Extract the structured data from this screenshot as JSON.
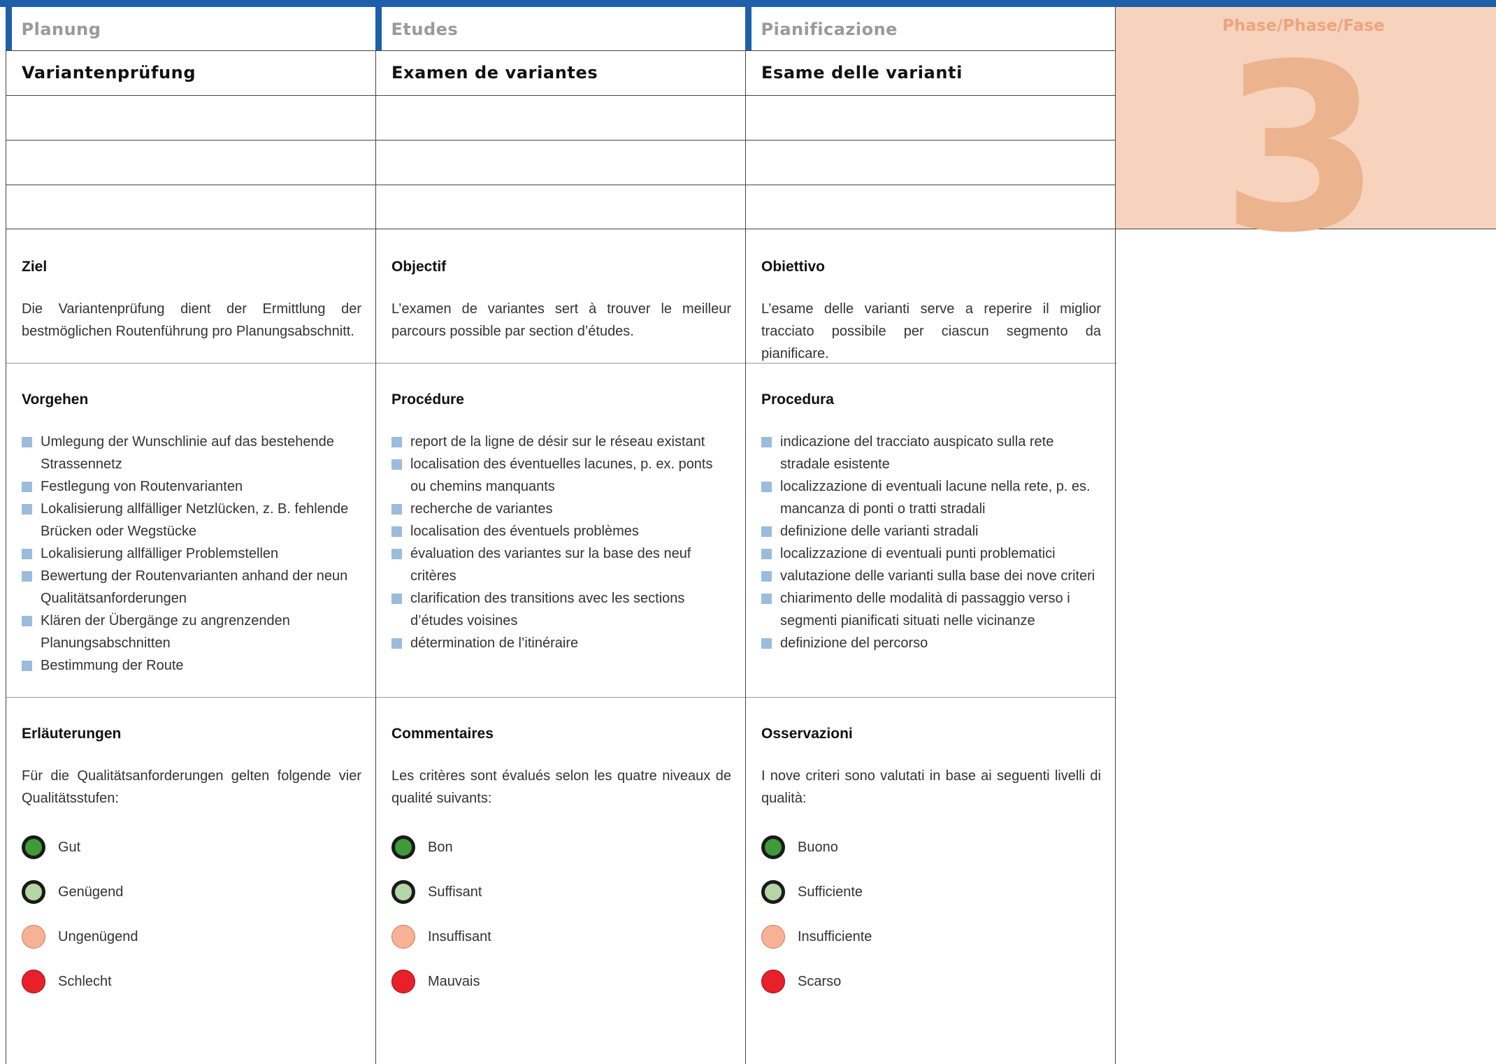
{
  "colors": {
    "accent": "#1d5fa8",
    "bullet": "#9bbcdc",
    "phase_bg": "#f7d2bd",
    "phase_text": "#ecb38f"
  },
  "columns": [
    {
      "header": "Planung",
      "title": "Variantenprüfung",
      "goal_heading": "Ziel",
      "goal_text": "Die Variantenprüfung dient der Ermittlung der bestmöglichen Routenführung pro Planungsabschnitt.",
      "proc_heading": "Vorgehen",
      "proc_items": [
        "Umlegung der Wunschlinie auf das bestehende Strassennetz",
        "Festlegung von Routenvarianten",
        "Lokalisierung allfälliger Netzlücken, z. B. fehlende Brücken oder Wegstücke",
        "Lokalisierung allfälliger Problemstellen",
        "Bewertung der Routenvarianten anhand der neun Qualitätsanforderungen",
        "Klären der Übergänge zu angrenzenden Planungsabschnitten",
        "Bestimmung der Route"
      ],
      "expl_heading": "Erläuterungen",
      "expl_text": "Für die Qualitätsanforderungen gelten folgende vier Qualitätsstufen:",
      "levels": [
        "Gut",
        "Genügend",
        "Ungenügend",
        "Schlecht"
      ]
    },
    {
      "header": "Etudes",
      "title": "Examen de variantes",
      "goal_heading": "Objectif",
      "goal_text": "L’examen de variantes sert à trouver le meilleur parcours possible par section d’études.",
      "proc_heading": "Procédure",
      "proc_items": [
        "report de la ligne de désir sur le réseau existant",
        "localisation des éventuelles lacunes, p. ex. ponts ou chemins manquants",
        "recherche de variantes",
        "localisation des éventuels problèmes",
        "évaluation des variantes sur la base des neuf critères",
        "clarification des transitions avec les sections d’études voisines",
        "détermination de l’itinéraire"
      ],
      "expl_heading": "Commentaires",
      "expl_text": "Les critères sont évalués selon les quatre niveaux de qualité suivants:",
      "levels": [
        "Bon",
        "Suffisant",
        "Insuffisant",
        "Mauvais"
      ]
    },
    {
      "header": "Pianificazione",
      "title": "Esame delle varianti",
      "goal_heading": "Obiettivo",
      "goal_text": "L’esame delle varianti serve a reperire il miglior tracciato possibile per ciascun segmento da pianificare.",
      "proc_heading": "Procedura",
      "proc_items": [
        "indicazione del tracciato auspicato sulla rete stradale esistente",
        "localizzazione di eventuali lacune nella rete, p. es. mancanza di ponti o tratti stradali",
        "definizione delle varianti stradali",
        "localizzazione di eventuali punti problematici",
        "valutazione delle varianti sulla base dei nove criteri",
        "chiarimento delle modalità di passaggio verso i segmenti pianificati situati nelle vicinanze",
        "definizione del percorso"
      ],
      "expl_heading": "Osservazioni",
      "expl_text": "I nove criteri sono valutati in base ai seguenti livelli di qualità:",
      "levels": [
        "Buono",
        "Sufficiente",
        "Insufficiente",
        "Scarso"
      ]
    }
  ],
  "phase": {
    "label": "Phase/Phase/Fase",
    "number": "3"
  }
}
